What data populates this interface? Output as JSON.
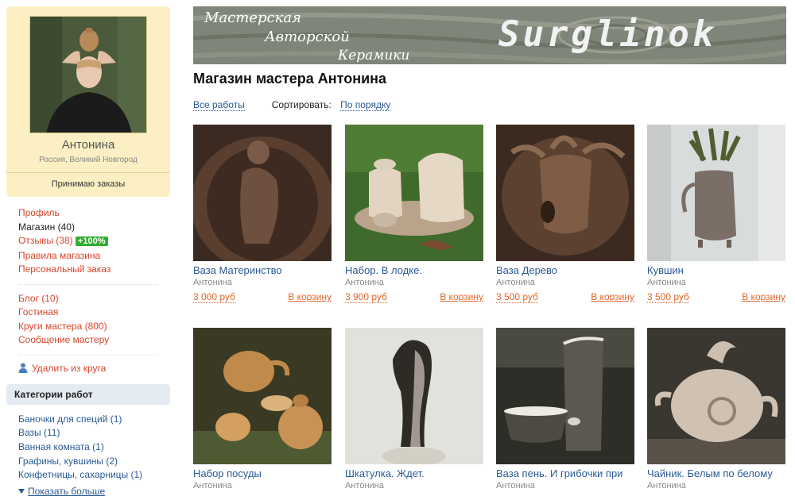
{
  "profile": {
    "name": "Антонина",
    "location": "Россия, Великий Новгород",
    "status": "Принимаю заказы"
  },
  "nav": {
    "profile": "Профиль",
    "shop": "Магазин (40)",
    "reviews": "Отзывы (38)",
    "reviews_badge": "+100%",
    "rules": "Правила магазина",
    "custom_order": "Персональный заказ",
    "blog": "Блог (10)",
    "guestbook": "Гостиная",
    "circles": "Круги мастера (800)",
    "message": "Сообщение мастеру",
    "remove": "Удалить из круга"
  },
  "categories": {
    "title": "Категории работ",
    "items": [
      "Баночки для специй (1)",
      "Вазы (11)",
      "Ванная комната (1)",
      "Графины, кувшины (2)",
      "Конфетницы, сахарницы (1)"
    ],
    "more": "Показать больше"
  },
  "banner": {
    "line1": "Мастерская",
    "line2": "Авторской",
    "line3": "Керамики",
    "brand": "Surglinok"
  },
  "shop": {
    "title": "Магазин мастера Антонина",
    "all_works": "Все работы",
    "sort_label": "Сортировать:",
    "sort_value": "По порядку"
  },
  "products": [
    {
      "name": "Ваза Материнство",
      "author": "Антонина",
      "price": "3 000 руб",
      "cart": "В корзину"
    },
    {
      "name": "Набор. В лодке.",
      "author": "Антонина",
      "price": "3 900 руб",
      "cart": "В корзину"
    },
    {
      "name": "Ваза Дерево",
      "author": "Антонина",
      "price": "3 500 руб",
      "cart": "В корзину"
    },
    {
      "name": "Кувшин",
      "author": "Антонина",
      "price": "3 500 руб",
      "cart": "В корзину"
    },
    {
      "name": "Набор посуды",
      "author": "Антонина",
      "price": "",
      "cart": ""
    },
    {
      "name": "Шкатулка. Ждет.",
      "author": "Антонина",
      "price": "",
      "cart": ""
    },
    {
      "name": "Ваза пень. И грибочки при",
      "author": "Антонина",
      "price": "",
      "cart": ""
    },
    {
      "name": "Чайник. Белым по белому",
      "author": "Антонина",
      "price": "",
      "cart": ""
    }
  ],
  "colors": {
    "link": "#2a5a96",
    "accent": "#d6452b",
    "price": "#e2662b",
    "profile_bg": "#fbefc3",
    "badge": "#2fae2f"
  }
}
